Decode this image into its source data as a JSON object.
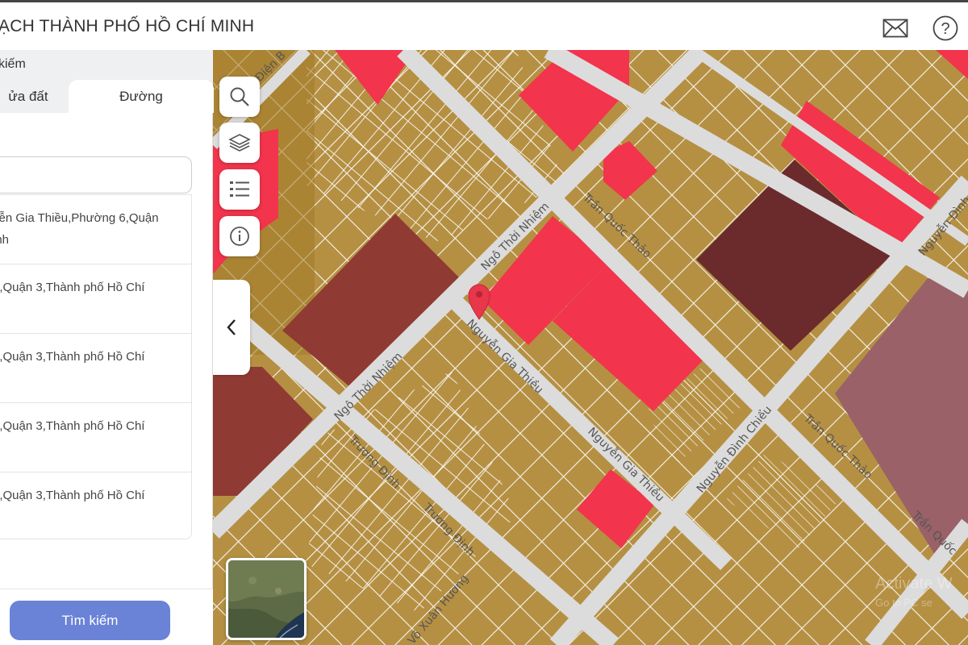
{
  "header": {
    "title": "ẠCH THÀNH PHỐ HỒ CHÍ MINH",
    "mail_icon": "mail-icon",
    "help_icon": "help-icon"
  },
  "panel": {
    "title": "kiếm",
    "tabs": [
      {
        "label": "ửa đất",
        "active": false
      },
      {
        "label": "Đường",
        "active": true
      }
    ],
    "search": {
      "value": "",
      "placeholder": ""
    },
    "results": [
      {
        "line1": "yễn Gia Thiều,Phường 6,Quận",
        "line2": "inh"
      },
      {
        "line1": "6,Quận 3,Thành phố Hồ Chí",
        "line2": ""
      },
      {
        "line1": "6,Quận 3,Thành phố Hồ Chí",
        "line2": ""
      },
      {
        "line1": "6,Quận 3,Thành phố Hồ Chí",
        "line2": ""
      },
      {
        "line1": "6,Quận 3,Thành phố Hồ Chí",
        "line2": ""
      }
    ],
    "search_button": "Tìm kiếm"
  },
  "map": {
    "roads": {
      "dien_bien": "Điện B",
      "ngo_thoi_nhiem_top": "Ngô Thời Nhiệm",
      "tran_quoc_thao_top": "Trần Quốc Thảo",
      "nguyen_dinh_top": "Nguyễn Đình",
      "nguyen_gia_thieu_1": "Nguyễn Gia Thiều",
      "ngo_thoi_nhiem_bottom": "Ngô Thời Nhiệm",
      "nguyen_gia_thieu_2": "Nguyễn Gia Thiều",
      "nguyen_dinh_chieu": "Nguyễn Đình Chiểu",
      "tran_quoc_thao_mid": "Trần Quốc Thảo",
      "truong_dinh_1": "Trương Định",
      "truong_dinh_2": "Trương Định",
      "tran_quoc_right": "Trần Quốc",
      "vo_xuan_huong": "Võ Xuân Hương"
    },
    "colors": {
      "residential": "#b59043",
      "residential_dark": "#a6822f",
      "commercial_red": "#f2344c",
      "public_brown": "#8f3a33",
      "dark_maroon": "#6b2b2d",
      "mauve": "#9a6168",
      "road": "#dcdcdc"
    },
    "tools": [
      "search-icon",
      "layers-icon",
      "legend-list-icon",
      "info-icon"
    ],
    "collapse_icon": "chevron-left-icon",
    "minimap_label": "satellite",
    "watermark_line1": "Activate W",
    "watermark_line2": "Go to PC se"
  }
}
